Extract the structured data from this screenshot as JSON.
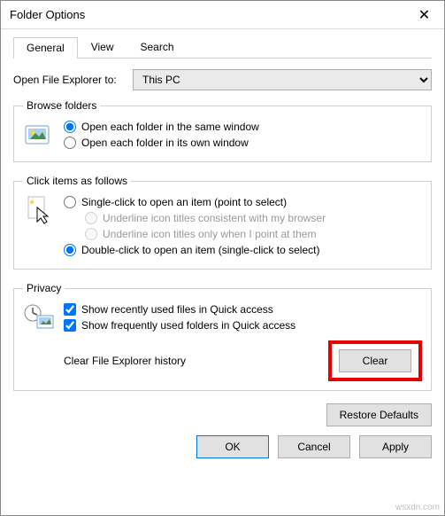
{
  "window": {
    "title": "Folder Options"
  },
  "tabs": {
    "general": "General",
    "view": "View",
    "search": "Search"
  },
  "open_to": {
    "label": "Open File Explorer to:",
    "value": "This PC"
  },
  "browse": {
    "legend": "Browse folders",
    "same_window": "Open each folder in the same window",
    "own_window": "Open each folder in its own window"
  },
  "click_items": {
    "legend": "Click items as follows",
    "single": "Single-click to open an item (point to select)",
    "underline_browser": "Underline icon titles consistent with my browser",
    "underline_point": "Underline icon titles only when I point at them",
    "double": "Double-click to open an item (single-click to select)"
  },
  "privacy": {
    "legend": "Privacy",
    "recent_files": "Show recently used files in Quick access",
    "frequent_folders": "Show frequently used folders in Quick access",
    "clear_label": "Clear File Explorer history",
    "clear_button": "Clear"
  },
  "buttons": {
    "restore": "Restore Defaults",
    "ok": "OK",
    "cancel": "Cancel",
    "apply": "Apply"
  },
  "watermark": "wsxdn.com"
}
